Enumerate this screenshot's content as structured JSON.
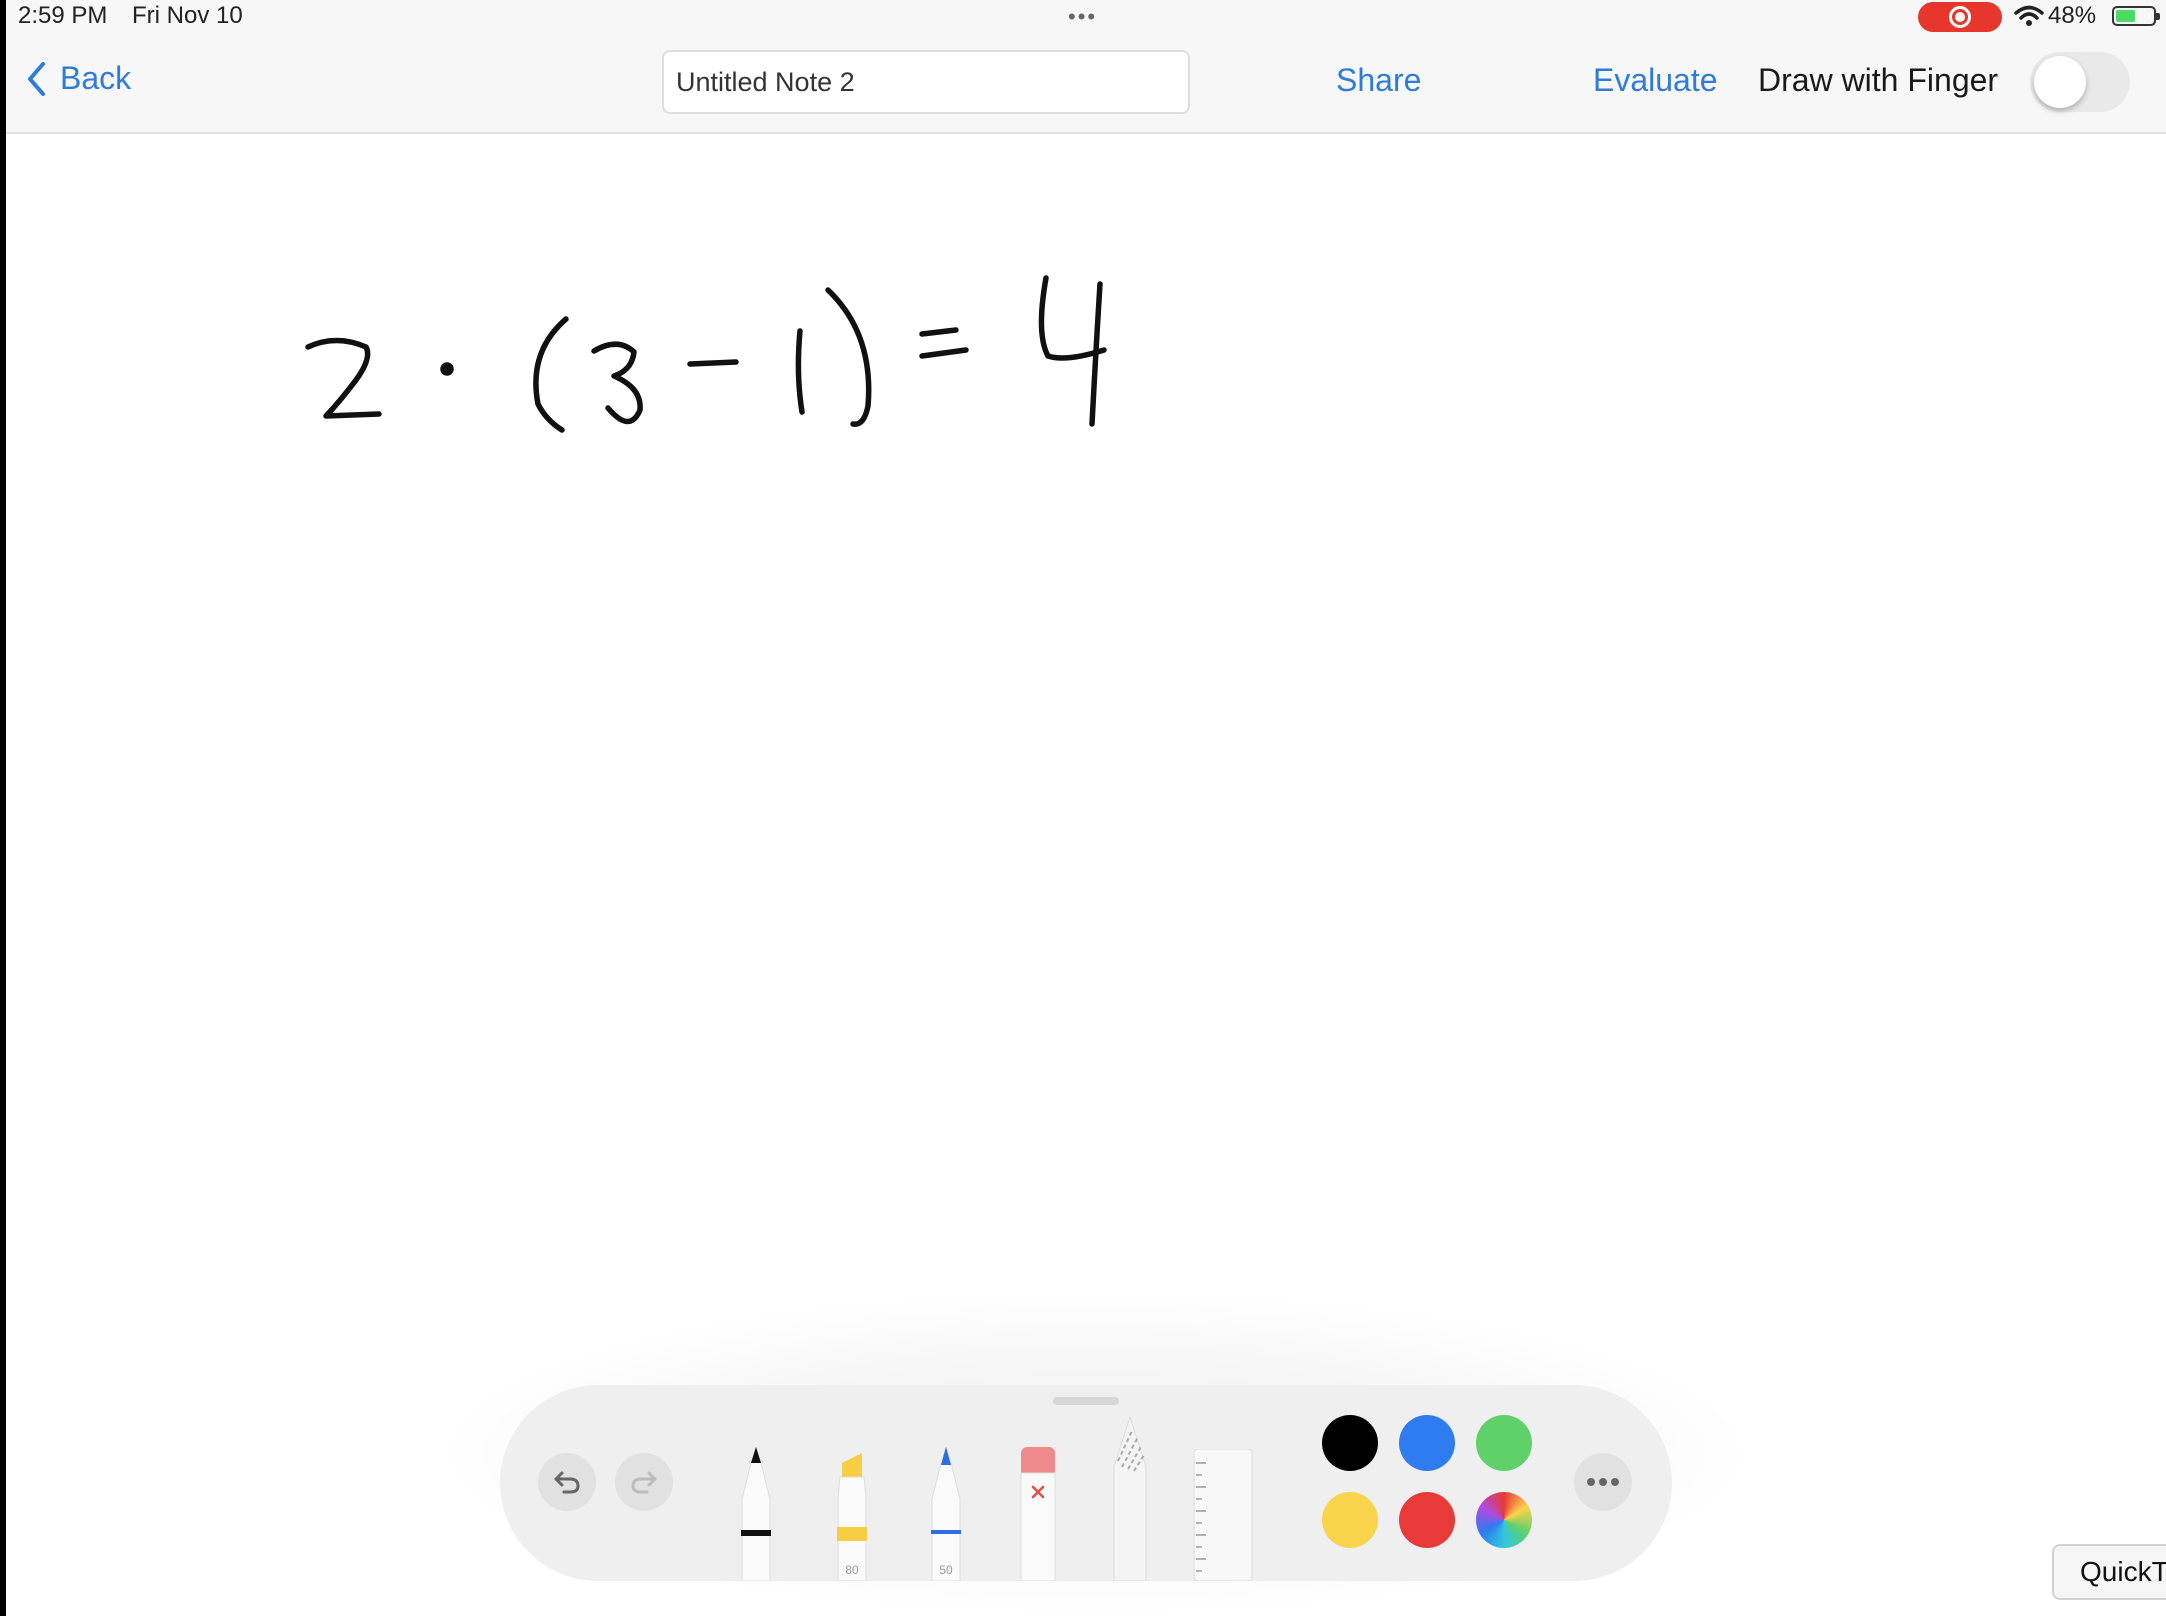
{
  "status": {
    "time": "2:59 PM",
    "date": "Fri Nov 10",
    "more_dots": "•••",
    "battery": "48%",
    "record_icon": "screen-record-icon",
    "wifi_icon": "wifi-icon",
    "battery_icon": "battery-charging-icon"
  },
  "nav": {
    "back_label": "Back",
    "title_value": "Untitled Note 2",
    "share_label": "Share",
    "evaluate_label": "Evaluate",
    "draw_label": "Draw with Finger",
    "toggle_on": false
  },
  "canvas": {
    "ink_color": "#111111"
  },
  "palette": {
    "tools": [
      {
        "name": "pen",
        "label": ""
      },
      {
        "name": "marker",
        "label": "80"
      },
      {
        "name": "pencil",
        "label": "50"
      },
      {
        "name": "eraser",
        "label": ""
      },
      {
        "name": "lasso",
        "label": ""
      },
      {
        "name": "ruler",
        "label": ""
      }
    ],
    "colors": [
      "#000000",
      "#2f7bf0",
      "#5fd06a",
      "#f9d34c",
      "#e83a38",
      "multicolor"
    ]
  },
  "quicktime_label": "QuickT",
  "accent_color": "#2f7bd9"
}
